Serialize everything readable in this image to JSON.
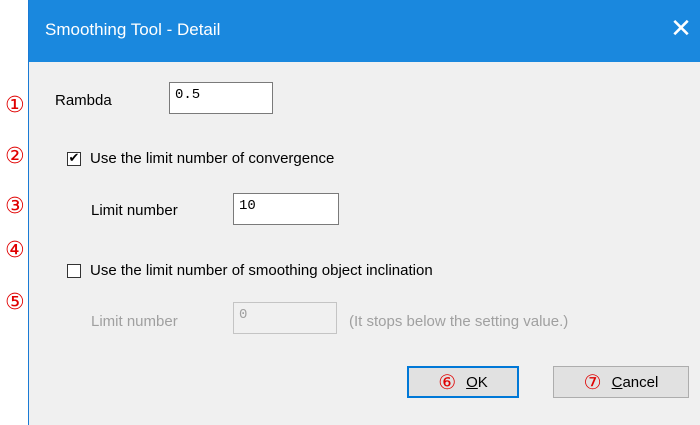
{
  "dialog": {
    "title": "Smoothing Tool - Detail",
    "close_glyph": "✕"
  },
  "rambda": {
    "label": "Rambda",
    "value": "0.5"
  },
  "convergence": {
    "checkbox_label": "Use the limit number of convergence",
    "checked": true,
    "check_glyph": "✔",
    "limit_label": "Limit number",
    "limit_value": "10"
  },
  "inclination": {
    "checkbox_label": "Use the limit number of smoothing object inclination",
    "checked": false,
    "limit_label": "Limit number",
    "limit_value": "0",
    "note": "(It stops below the setting value.)"
  },
  "buttons": {
    "ok_first": "O",
    "ok_rest": "K",
    "cancel_first": "C",
    "cancel_rest": "ancel"
  },
  "markers": [
    "①",
    "②",
    "③",
    "④",
    "⑤",
    "⑥",
    "⑦"
  ],
  "colors": {
    "titlebar": "#1a88de",
    "marker": "#e00000",
    "disabled_text": "#a0a0a0"
  }
}
